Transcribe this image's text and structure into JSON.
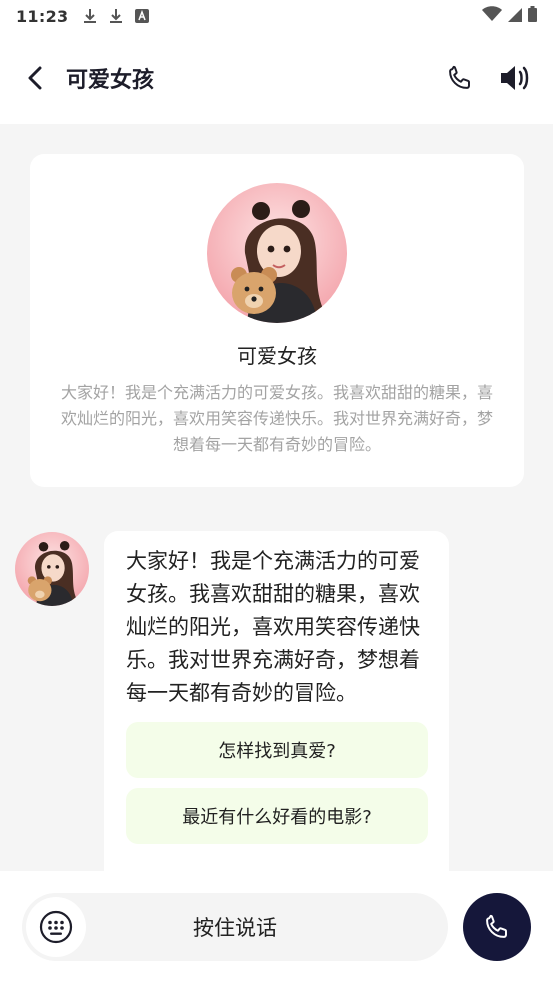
{
  "status_bar": {
    "time": "11:23",
    "icons": [
      "download-icon",
      "download-icon",
      "text-a-icon"
    ],
    "right_icons": [
      "wifi-icon",
      "signal-icon",
      "battery-icon"
    ]
  },
  "header": {
    "title": "可爱女孩",
    "back_icon": "chevron-left-icon",
    "actions": [
      "phone-icon",
      "speaker-icon"
    ]
  },
  "profile": {
    "name": "可爱女孩",
    "intro": "大家好！我是个充满活力的可爱女孩。我喜欢甜甜的糖果，喜欢灿烂的阳光，喜欢用笑容传递快乐。我对世界充满好奇，梦想着每一天都有奇妙的冒险。"
  },
  "chat": {
    "message": "大家好！我是个充满活力的可爱女孩。我喜欢甜甜的糖果，喜欢灿烂的阳光，喜欢用笑容传递快乐。我对世界充满好奇，梦想着每一天都有奇妙的冒险。",
    "suggestions": [
      "怎样找到真爱?",
      "最近有什么好看的电影?"
    ]
  },
  "bottom": {
    "voice_label": "按住说话",
    "keyboard_icon": "keyboard-icon",
    "call_icon": "phone-icon"
  },
  "colors": {
    "accent_dark": "#15173a",
    "suggestion_bg": "#f4fde9",
    "avatar_bg": "#f7b7bd"
  }
}
